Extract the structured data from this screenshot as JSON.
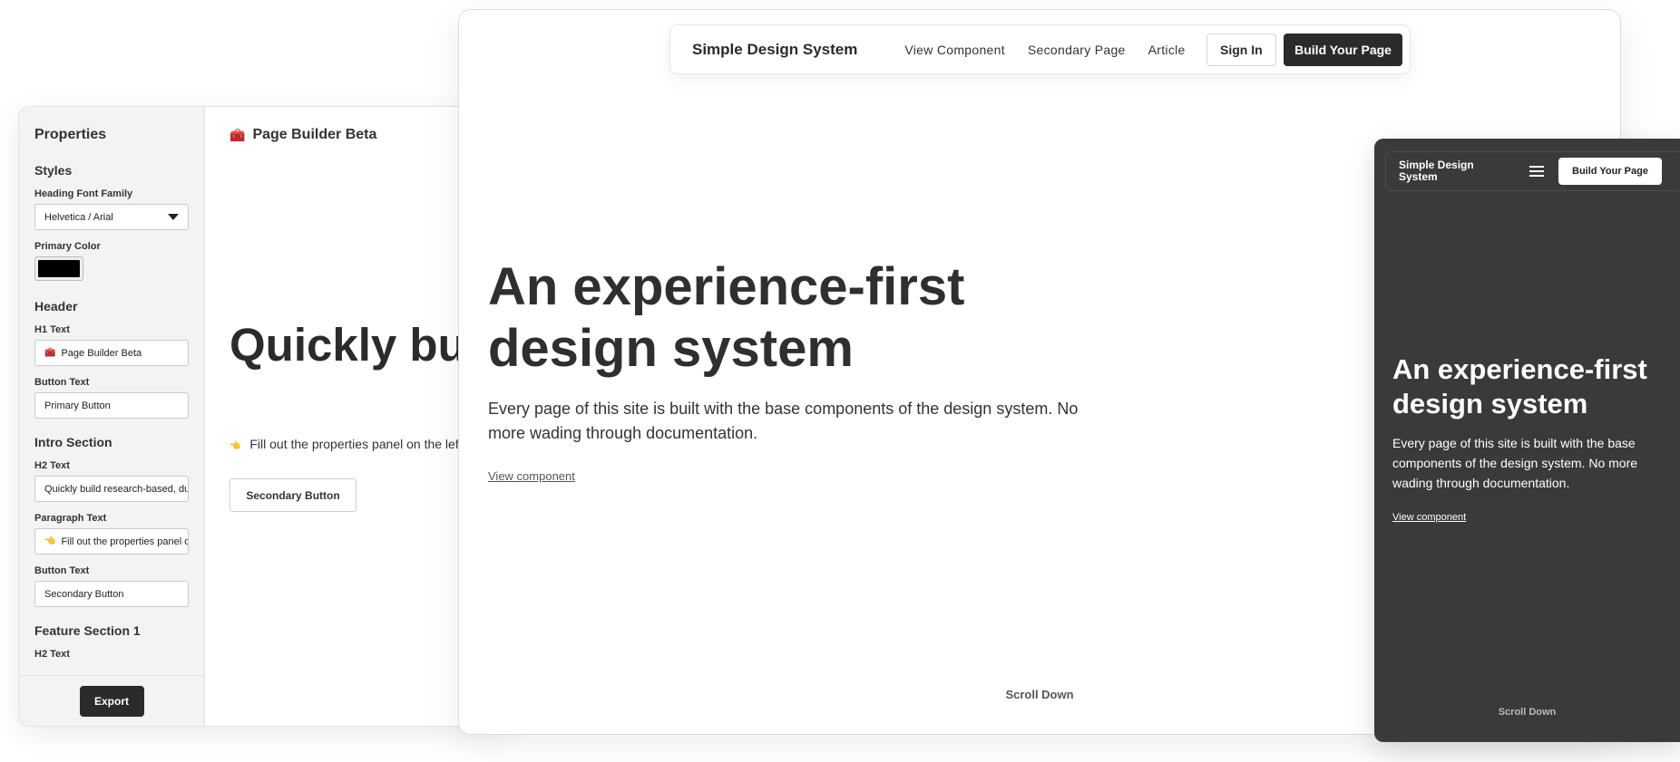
{
  "builder": {
    "properties": {
      "title": "Properties",
      "styles": {
        "heading": "Styles",
        "heading_font_label": "Heading Font Family",
        "heading_font_value": "Helvetica / Arial",
        "primary_color_label": "Primary Color",
        "primary_color_value": "#000000"
      },
      "header": {
        "heading": "Header",
        "h1_label": "H1 Text",
        "h1_icon": "🧰",
        "h1_value": "Page Builder Beta",
        "button_label": "Button Text",
        "button_value": "Primary Button"
      },
      "intro": {
        "heading": "Intro Section",
        "h2_label": "H2 Text",
        "h2_value": "Quickly build research-based, durable websites",
        "paragraph_label": "Paragraph Text",
        "paragraph_icon": "👈",
        "paragraph_value": "Fill out the properties panel on the left",
        "button_label": "Button Text",
        "button_value": "Secondary Button"
      },
      "feature1": {
        "heading": "Feature Section 1",
        "h2_label": "H2 Text"
      },
      "export_label": "Export"
    },
    "canvas": {
      "title_icon": "🧰",
      "title": "Page Builder Beta",
      "h2": "Quickly build research-based, durable websites",
      "paragraph_icon": "👈",
      "paragraph": "Fill out the properties panel on the left, and see your page build itself here.",
      "button_label": "Secondary Button"
    }
  },
  "desktop": {
    "nav": {
      "brand": "Simple Design System",
      "links": [
        "View Component",
        "Secondary Page",
        "Article"
      ],
      "sign_in": "Sign In",
      "build": "Build Your Page"
    },
    "hero": {
      "title": "An experience-first design system",
      "paragraph": "Every page of this site is built with the base components of the design system. No more wading through documentation.",
      "link": "View component"
    },
    "scroll_label": "Scroll Down"
  },
  "mobile": {
    "nav": {
      "brand": "Simple Design System",
      "menu_icon": "hamburger-icon",
      "build": "Build Your Page"
    },
    "hero": {
      "title": "An experience-first design system",
      "paragraph": "Every page of this site is built with the base components of the design system. No more wading through documentation.",
      "link": "View component"
    },
    "scroll_label": "Scroll Down"
  }
}
